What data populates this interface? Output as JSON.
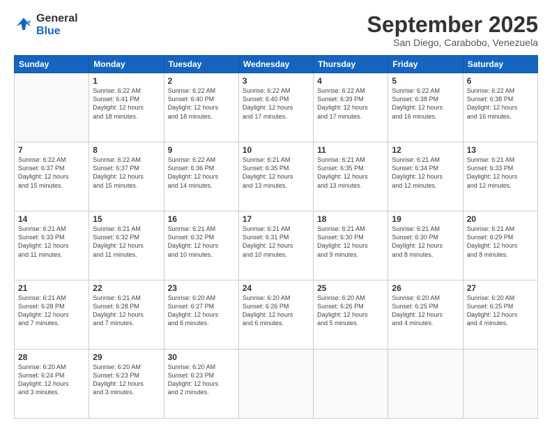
{
  "logo": {
    "line1": "General",
    "line2": "Blue"
  },
  "header": {
    "month": "September 2025",
    "location": "San Diego, Carabobo, Venezuela"
  },
  "days_of_week": [
    "Sunday",
    "Monday",
    "Tuesday",
    "Wednesday",
    "Thursday",
    "Friday",
    "Saturday"
  ],
  "weeks": [
    [
      {
        "day": "",
        "info": ""
      },
      {
        "day": "1",
        "info": "Sunrise: 6:22 AM\nSunset: 6:41 PM\nDaylight: 12 hours\nand 18 minutes."
      },
      {
        "day": "2",
        "info": "Sunrise: 6:22 AM\nSunset: 6:40 PM\nDaylight: 12 hours\nand 18 minutes."
      },
      {
        "day": "3",
        "info": "Sunrise: 6:22 AM\nSunset: 6:40 PM\nDaylight: 12 hours\nand 17 minutes."
      },
      {
        "day": "4",
        "info": "Sunrise: 6:22 AM\nSunset: 6:39 PM\nDaylight: 12 hours\nand 17 minutes."
      },
      {
        "day": "5",
        "info": "Sunrise: 6:22 AM\nSunset: 6:38 PM\nDaylight: 12 hours\nand 16 minutes."
      },
      {
        "day": "6",
        "info": "Sunrise: 6:22 AM\nSunset: 6:38 PM\nDaylight: 12 hours\nand 16 minutes."
      }
    ],
    [
      {
        "day": "7",
        "info": "Sunrise: 6:22 AM\nSunset: 6:37 PM\nDaylight: 12 hours\nand 15 minutes."
      },
      {
        "day": "8",
        "info": "Sunrise: 6:22 AM\nSunset: 6:37 PM\nDaylight: 12 hours\nand 15 minutes."
      },
      {
        "day": "9",
        "info": "Sunrise: 6:22 AM\nSunset: 6:36 PM\nDaylight: 12 hours\nand 14 minutes."
      },
      {
        "day": "10",
        "info": "Sunrise: 6:21 AM\nSunset: 6:35 PM\nDaylight: 12 hours\nand 13 minutes."
      },
      {
        "day": "11",
        "info": "Sunrise: 6:21 AM\nSunset: 6:35 PM\nDaylight: 12 hours\nand 13 minutes."
      },
      {
        "day": "12",
        "info": "Sunrise: 6:21 AM\nSunset: 6:34 PM\nDaylight: 12 hours\nand 12 minutes."
      },
      {
        "day": "13",
        "info": "Sunrise: 6:21 AM\nSunset: 6:33 PM\nDaylight: 12 hours\nand 12 minutes."
      }
    ],
    [
      {
        "day": "14",
        "info": "Sunrise: 6:21 AM\nSunset: 6:33 PM\nDaylight: 12 hours\nand 11 minutes."
      },
      {
        "day": "15",
        "info": "Sunrise: 6:21 AM\nSunset: 6:32 PM\nDaylight: 12 hours\nand 11 minutes."
      },
      {
        "day": "16",
        "info": "Sunrise: 6:21 AM\nSunset: 6:32 PM\nDaylight: 12 hours\nand 10 minutes."
      },
      {
        "day": "17",
        "info": "Sunrise: 6:21 AM\nSunset: 6:31 PM\nDaylight: 12 hours\nand 10 minutes."
      },
      {
        "day": "18",
        "info": "Sunrise: 6:21 AM\nSunset: 6:30 PM\nDaylight: 12 hours\nand 9 minutes."
      },
      {
        "day": "19",
        "info": "Sunrise: 6:21 AM\nSunset: 6:30 PM\nDaylight: 12 hours\nand 8 minutes."
      },
      {
        "day": "20",
        "info": "Sunrise: 6:21 AM\nSunset: 6:29 PM\nDaylight: 12 hours\nand 8 minutes."
      }
    ],
    [
      {
        "day": "21",
        "info": "Sunrise: 6:21 AM\nSunset: 6:28 PM\nDaylight: 12 hours\nand 7 minutes."
      },
      {
        "day": "22",
        "info": "Sunrise: 6:21 AM\nSunset: 6:28 PM\nDaylight: 12 hours\nand 7 minutes."
      },
      {
        "day": "23",
        "info": "Sunrise: 6:20 AM\nSunset: 6:27 PM\nDaylight: 12 hours\nand 6 minutes."
      },
      {
        "day": "24",
        "info": "Sunrise: 6:20 AM\nSunset: 6:26 PM\nDaylight: 12 hours\nand 6 minutes."
      },
      {
        "day": "25",
        "info": "Sunrise: 6:20 AM\nSunset: 6:26 PM\nDaylight: 12 hours\nand 5 minutes."
      },
      {
        "day": "26",
        "info": "Sunrise: 6:20 AM\nSunset: 6:25 PM\nDaylight: 12 hours\nand 4 minutes."
      },
      {
        "day": "27",
        "info": "Sunrise: 6:20 AM\nSunset: 6:25 PM\nDaylight: 12 hours\nand 4 minutes."
      }
    ],
    [
      {
        "day": "28",
        "info": "Sunrise: 6:20 AM\nSunset: 6:24 PM\nDaylight: 12 hours\nand 3 minutes."
      },
      {
        "day": "29",
        "info": "Sunrise: 6:20 AM\nSunset: 6:23 PM\nDaylight: 12 hours\nand 3 minutes."
      },
      {
        "day": "30",
        "info": "Sunrise: 6:20 AM\nSunset: 6:23 PM\nDaylight: 12 hours\nand 2 minutes."
      },
      {
        "day": "",
        "info": ""
      },
      {
        "day": "",
        "info": ""
      },
      {
        "day": "",
        "info": ""
      },
      {
        "day": "",
        "info": ""
      }
    ]
  ]
}
